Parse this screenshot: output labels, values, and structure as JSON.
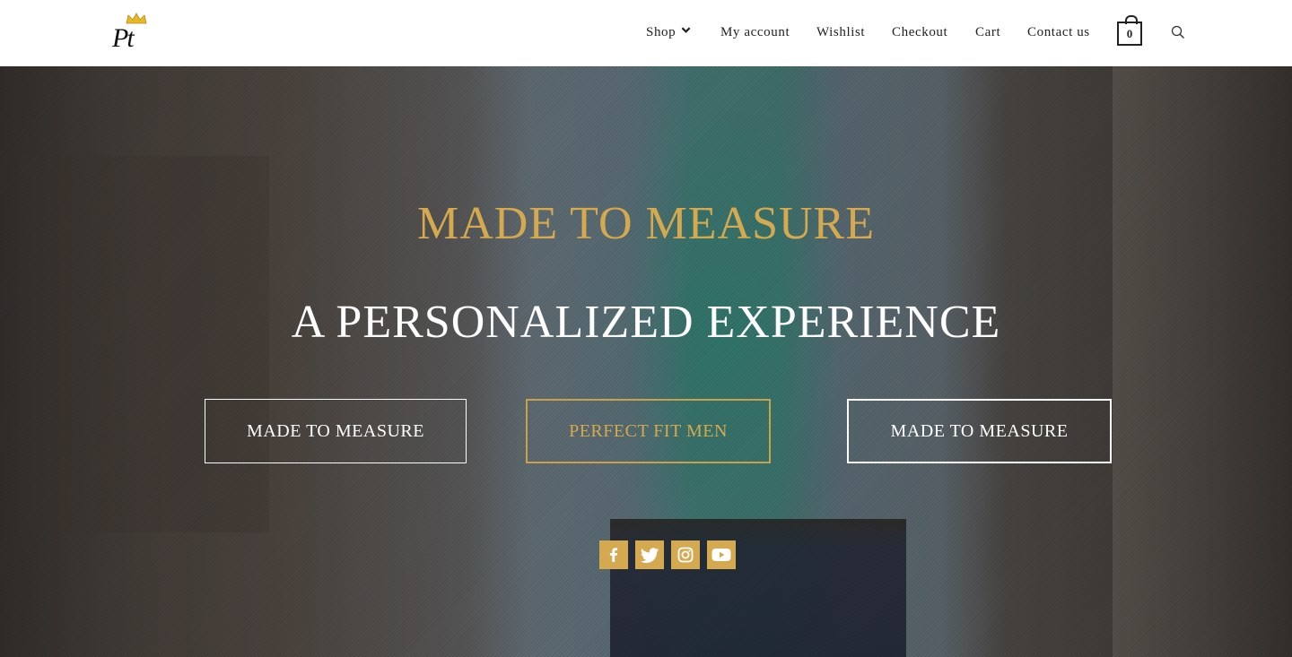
{
  "brand": {
    "logo_text": "Pt"
  },
  "nav": {
    "items": [
      {
        "label": "Shop",
        "has_dropdown": true
      },
      {
        "label": "My account"
      },
      {
        "label": "Wishlist"
      },
      {
        "label": "Checkout"
      },
      {
        "label": "Cart"
      },
      {
        "label": "Contact us"
      }
    ],
    "cart_count": "0",
    "icons": {
      "search": "search-icon",
      "cart": "cart-icon",
      "dropdown": "chevron-down-icon"
    }
  },
  "hero": {
    "title": "MADE TO MEASURE",
    "subtitle": "A PERSONALIZED EXPERIENCE",
    "buttons": [
      {
        "label": "MADE TO MEASURE"
      },
      {
        "label": "PERFECT FIT MEN"
      },
      {
        "label": "MADE TO MEASURE"
      }
    ],
    "socials": [
      "facebook-icon",
      "twitter-icon",
      "instagram-icon",
      "youtube-icon"
    ]
  },
  "colors": {
    "accent": "#d4a94f",
    "text_dark": "#222222",
    "hero_text": "#ffffff"
  }
}
